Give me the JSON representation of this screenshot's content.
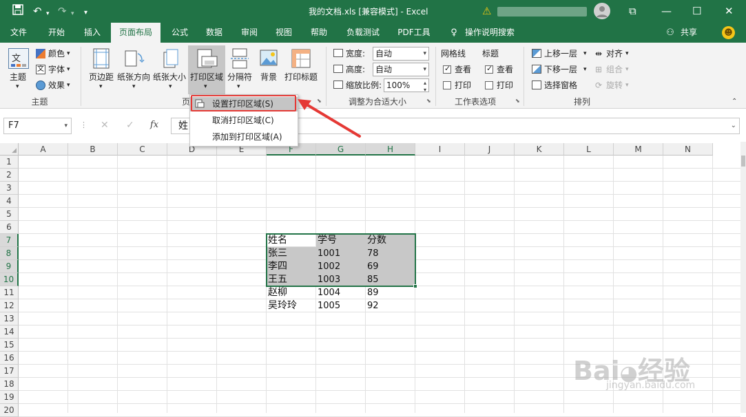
{
  "titlebar": {
    "doc_title": "我的文档.xls  [兼容模式]  -  Excel",
    "icons": [
      "save-icon",
      "undo-icon",
      "redo-icon",
      "customize-icon",
      "warning-icon",
      "account-icon",
      "ribbon-display-icon",
      "minimize-icon",
      "maximize-icon",
      "close-icon"
    ]
  },
  "tabs": [
    {
      "label": "文件"
    },
    {
      "label": "开始"
    },
    {
      "label": "插入"
    },
    {
      "label": "页面布局"
    },
    {
      "label": "公式"
    },
    {
      "label": "数据"
    },
    {
      "label": "审阅"
    },
    {
      "label": "视图"
    },
    {
      "label": "帮助"
    },
    {
      "label": "负载测试"
    },
    {
      "label": "PDF工具"
    },
    {
      "label": "操作说明搜索"
    }
  ],
  "share_label": "共享",
  "ribbon": {
    "themes": {
      "theme": "主题",
      "colors": "颜色",
      "fonts": "字体",
      "effects": "效果",
      "group": "主题"
    },
    "page_setup": {
      "margins": "页边距",
      "orientation": "纸张方向",
      "size": "纸张大小",
      "print_area": "打印区域",
      "breaks": "分隔符",
      "background": "背景",
      "print_titles": "打印标题",
      "group": "页"
    },
    "scale": {
      "width_label": "宽度:",
      "width_value": "自动",
      "height_label": "高度:",
      "height_value": "自动",
      "scale_label": "缩放比例:",
      "scale_value": "100%",
      "group": "调整为合适大小"
    },
    "sheet_options": {
      "gridlines": "网格线",
      "headings": "标题",
      "view": "查看",
      "print": "打印",
      "group": "工作表选项",
      "gridlines_view": true,
      "gridlines_print": false,
      "headings_view": true,
      "headings_print": false
    },
    "arrange": {
      "bring_forward": "上移一层",
      "send_backward": "下移一层",
      "selection_pane": "选择窗格",
      "align": "对齐",
      "group_btn": "组合",
      "rotate": "旋转",
      "group": "排列"
    }
  },
  "print_area_menu": [
    {
      "label": "设置打印区域(S)"
    },
    {
      "label": "取消打印区域(C)"
    },
    {
      "label": "添加到打印区域(A)"
    }
  ],
  "formula_bar": {
    "name_box": "F7",
    "formula": "姓"
  },
  "columns": [
    "A",
    "B",
    "C",
    "D",
    "E",
    "F",
    "G",
    "H",
    "I",
    "J",
    "K",
    "L",
    "M",
    "N"
  ],
  "rows": [
    "1",
    "2",
    "3",
    "4",
    "5",
    "6",
    "7",
    "8",
    "9",
    "10",
    "11",
    "12",
    "13",
    "14",
    "15",
    "16",
    "17",
    "18",
    "19",
    "20"
  ],
  "table": [
    [
      "姓名",
      "学号",
      "分数"
    ],
    [
      "张三",
      "1001",
      "78"
    ],
    [
      "李四",
      "1002",
      "69"
    ],
    [
      "王五",
      "1003",
      "85"
    ],
    [
      "赵柳",
      "1004",
      "89"
    ],
    [
      "吴玲玲",
      "1005",
      "92"
    ]
  ],
  "colors": {
    "accent": "#217346",
    "annotation": "#e53935",
    "selection": "#c8c8c8"
  },
  "watermark": "Baidu经验 jingyan.baidu.com"
}
